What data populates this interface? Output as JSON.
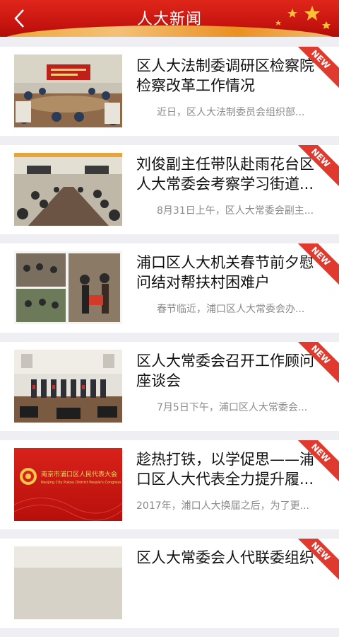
{
  "header": {
    "title": "人大新闻",
    "back_icon": "chevron-left-icon"
  },
  "badge_text": "NEW",
  "news": [
    {
      "title": "区人大法制委调研区检察院检察改革工作情况",
      "summary": "近日，区人大法制委员会组织部..."
    },
    {
      "title": "刘俊副主任带队赴雨花台区人大常委会考察学习街道...",
      "summary": "8月31日上午，区人大常委会副主..."
    },
    {
      "title": "浦口区人大机关春节前夕慰问结对帮扶村困难户",
      "summary": "春节临近，浦口区人大常委会办..."
    },
    {
      "title": "区人大常委会召开工作顾问座谈会",
      "summary": "7月5日下午，浦口区人大常委会..."
    },
    {
      "title": "趁热打铁，以学促思——浦口区人大代表全力提升履...",
      "summary": "2017年，浦口人大换届之后，为了更...",
      "thumb_caption": "南京市浦口区人民代表大会",
      "thumb_caption_en": "Nanjing City Pukou District People's Congress"
    },
    {
      "title": "区人大常委会人代联委组织",
      "summary": ""
    }
  ],
  "colors": {
    "header_red": "#c5130e",
    "badge_red": "#e03a2f",
    "background": "#efeff3"
  }
}
